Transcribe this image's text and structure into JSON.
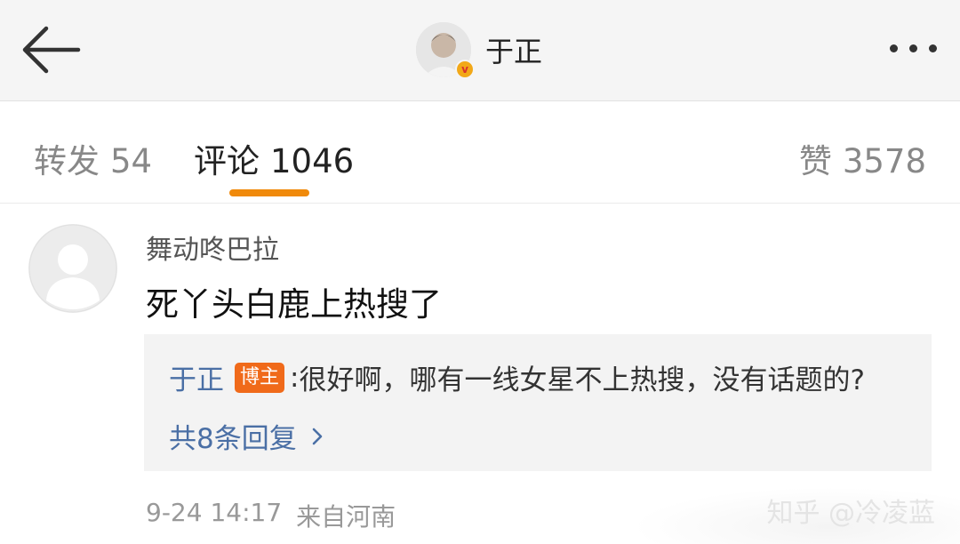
{
  "header": {
    "profile_name": "于正",
    "verified_mark": "v",
    "back_icon": "arrow-left-icon",
    "more_icon": "more-horizontal-icon"
  },
  "tabs": {
    "repost_label": "转发",
    "repost_count": "54",
    "comments_label": "评论",
    "comments_count": "1046",
    "likes_label": "赞",
    "likes_count": "3578",
    "active": "comments",
    "accent_color": "#f08a0b"
  },
  "comment": {
    "username": "舞动咚巴拉",
    "text": "死丫头白鹿上热搜了",
    "reply": {
      "author": "于正",
      "badge": "博主",
      "colon": ":",
      "text": "很好啊，哪有一线女星不上热搜，没有话题的?"
    },
    "more_replies": "共8条回复",
    "date": "9-24 14:17",
    "location": "来自河南"
  },
  "watermark": "知乎 @冷凌蓝"
}
